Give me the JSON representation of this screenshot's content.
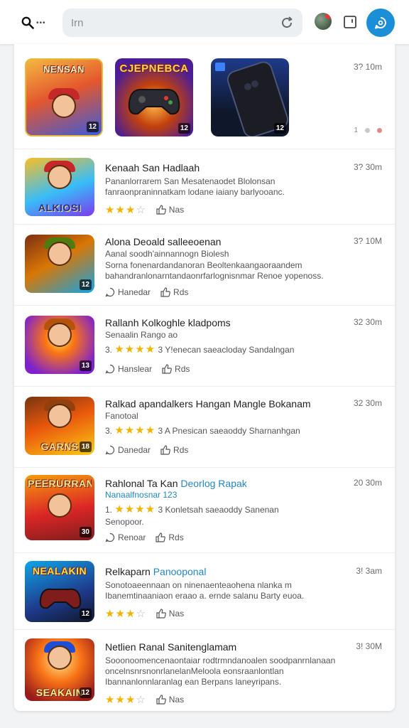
{
  "topbar": {
    "search_dots": "•••",
    "search_placeholder": "Irn",
    "icons": [
      "search-icon",
      "refresh-icon",
      "avatar",
      "tab-icon",
      "chat-icon"
    ],
    "accent": "#1a8fd8"
  },
  "featured": {
    "items": [
      {
        "title": "NENSAN",
        "age": "12"
      },
      {
        "title": "CJEPNEBCA",
        "age": "12"
      },
      {
        "title": "",
        "age": "12"
      }
    ],
    "meta": "3? 10m",
    "dots_label": "1"
  },
  "list": [
    {
      "title": "Kenaah San Hadlaah",
      "desc": "Pananlorrarem San Mesatenaodet Blolonsan fanraonpraninnatkam lodane iaiany barlyooanc.",
      "stars": 3,
      "thumb_title": "ALKIOSI",
      "age": "",
      "comment": "",
      "share": "Nas",
      "meta": "3? 30m"
    },
    {
      "title": "Alona Deoald salleeoenan",
      "line2": "Aanal soodh'ainnannogn Biolesh",
      "desc": "Sorna fonenardandanoran Beoltenkaangaoraandem bahandranlonarntandaonrfarlognisnmar Renoe yopenoss.",
      "stars": 0,
      "thumb_title": "",
      "age": "12",
      "comment": "Hanedar",
      "share": "Rds",
      "meta": "3? 10M"
    },
    {
      "title": "Rallanh Kolkoghle kladpoms",
      "line2": "Senaalin Rango ao",
      "rating_text": "3.",
      "stars": 4,
      "meta_text": "3 Y!enecan saeacloday Sandalngan",
      "thumb_title": "",
      "age": "13",
      "comment": "Hanslear",
      "share": "Rds",
      "meta": "32 30m"
    },
    {
      "title": "Ralkad apandalkers Hangan Mangle Bokanam",
      "line2": "Fanotoal",
      "rating_text": "3.",
      "stars": 4,
      "meta_text": "3 A Pnesican saeaoddy Sharnanhgan",
      "thumb_title": "GARNS",
      "age": "18",
      "comment": "Danedar",
      "share": "Rds",
      "meta": "32 30m"
    },
    {
      "title": "Rahlonal Ta Kan",
      "title_highlight": "Deorlog Rapak",
      "subtitle": "Nanaalfnosnar 123",
      "rating_text": "1.",
      "stars": 4,
      "meta_text": "3 Konletsah saeaoddy Sanenan",
      "line3": "Senopoor.",
      "thumb_title": "PEERURRAN",
      "age": "30",
      "comment": "Renoar",
      "share": "Rds",
      "meta": "20 30m"
    },
    {
      "title": "Relkaparn",
      "title_highlight": "Panooponal",
      "desc": "Sonotoaeennaan on ninenaenteaohena nlanka m Ibanemtinaaniaon eraao a. ernde salanu Barty euoa.",
      "stars": 3,
      "thumb_title": "NEALAKIN",
      "age": "12",
      "comment": "",
      "share": "Nas",
      "meta": "3! 3am"
    },
    {
      "title": "Netlien Ranal Sanitenglamam",
      "desc": "Sooonoomencenaontaiar rodtrmndanoalen soodpanrnlanaan oncelnsnrsnonrlanelanMeloola eonsraanlontlan Ibannanlonnlaranlag ean Berpans laneyripans.",
      "stars": 3,
      "thumb_title": "SEAKAIN",
      "age": "12",
      "comment": "",
      "share": "Nas",
      "meta": "3! 30M"
    }
  ]
}
